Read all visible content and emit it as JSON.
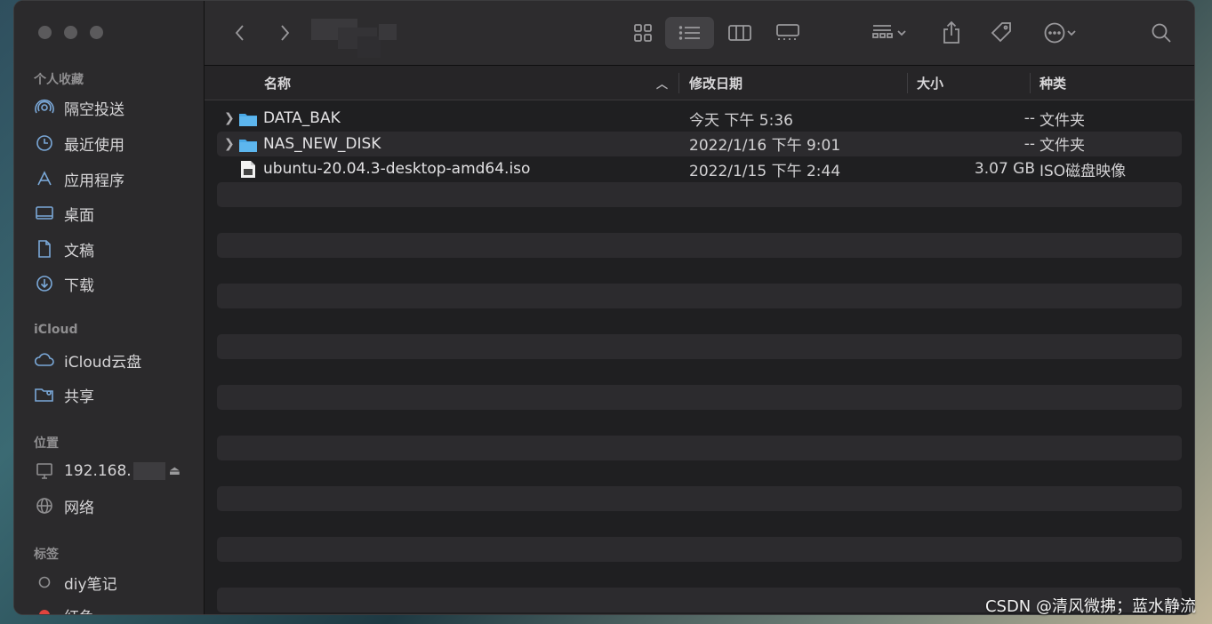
{
  "sidebar": {
    "favorites_title": "个人收藏",
    "favorites": [
      {
        "label": "隔空投送",
        "icon": "airdrop-icon"
      },
      {
        "label": "最近使用",
        "icon": "clock-icon"
      },
      {
        "label": "应用程序",
        "icon": "applications-icon"
      },
      {
        "label": "桌面",
        "icon": "desktop-icon"
      },
      {
        "label": "文稿",
        "icon": "document-icon"
      },
      {
        "label": "下载",
        "icon": "download-icon"
      }
    ],
    "icloud_title": "iCloud",
    "icloud": [
      {
        "label": "iCloud云盘",
        "icon": "cloud-icon"
      },
      {
        "label": "共享",
        "icon": "shared-folder-icon"
      }
    ],
    "locations_title": "位置",
    "locations": [
      {
        "label": "192.168.",
        "icon": "computer-icon"
      },
      {
        "label": "网络",
        "icon": "network-icon"
      }
    ],
    "tags_title": "标签",
    "tags": [
      {
        "label": "diy笔记",
        "color": "#8e8e90"
      },
      {
        "label": "红色",
        "color": "#e0443e"
      }
    ]
  },
  "columns": {
    "name": "名称",
    "date": "修改日期",
    "size": "大小",
    "kind": "种类"
  },
  "files": [
    {
      "name": "DATA_BAK",
      "date": "今天 下午 5:36",
      "size": "--",
      "kind": "文件夹",
      "type": "folder"
    },
    {
      "name": "NAS_NEW_DISK",
      "date": "2022/1/16 下午 9:01",
      "size": "--",
      "kind": "文件夹",
      "type": "folder"
    },
    {
      "name": "ubuntu-20.04.3-desktop-amd64.iso",
      "date": "2022/1/15 下午 2:44",
      "size": "3.07 GB",
      "kind": "ISO磁盘映像",
      "type": "file"
    }
  ],
  "watermark": "CSDN @清风微拂；蓝水静流",
  "colors": {
    "accent": "#7aa8d8",
    "folder": "#49a8e6",
    "window": "#1f1f21"
  }
}
